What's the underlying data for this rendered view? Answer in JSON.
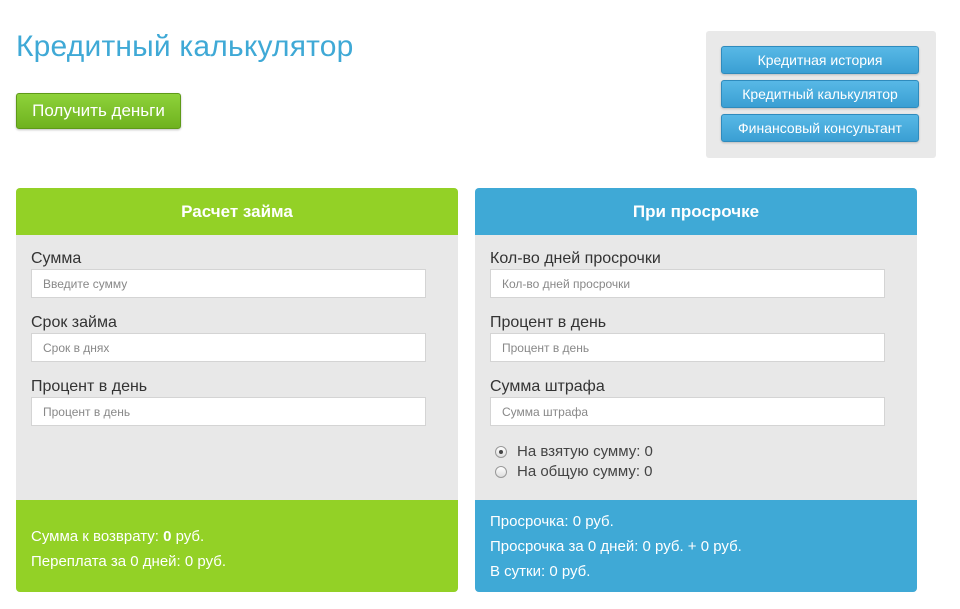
{
  "header": {
    "title": "Кредитный калькулятор",
    "get_money_label": "Получить деньги"
  },
  "nav": {
    "items": [
      {
        "label": "Кредитная история"
      },
      {
        "label": "Кредитный калькулятор"
      },
      {
        "label": "Финансовый консультант"
      }
    ]
  },
  "loan_panel": {
    "title": "Расчет займа",
    "fields": [
      {
        "label": "Сумма",
        "placeholder": "Введите сумму",
        "value": ""
      },
      {
        "label": "Срок займа",
        "placeholder": "Срок в днях",
        "value": ""
      },
      {
        "label": "Процент в день",
        "placeholder": "Процент в день",
        "value": ""
      }
    ],
    "footer": {
      "repay_prefix": "Сумма к возврату: ",
      "repay_value": "0",
      "repay_suffix": " руб.",
      "overpay_text": "Переплата за 0 дней: 0 руб."
    }
  },
  "overdue_panel": {
    "title": "При просрочке",
    "fields": [
      {
        "label": "Кол-во дней просрочки",
        "placeholder": "Кол-во дней просрочки",
        "value": ""
      },
      {
        "label": "Процент в день",
        "placeholder": "Процент в день",
        "value": ""
      },
      {
        "label": "Сумма штрафа",
        "placeholder": "Сумма штрафа",
        "value": ""
      }
    ],
    "options": [
      {
        "label": "На взятую сумму: 0",
        "checked": true
      },
      {
        "label": "На общую сумму: 0",
        "checked": false
      }
    ],
    "footer": {
      "line1": "Просрочка: 0 руб.",
      "line2": "Просрочка за 0 дней: 0 руб. + 0 руб.",
      "line3": "В сутки: 0 руб."
    }
  },
  "colors": {
    "green": "#93d126",
    "blue": "#3fa9d6",
    "panel_bg": "#e8e8e8"
  }
}
